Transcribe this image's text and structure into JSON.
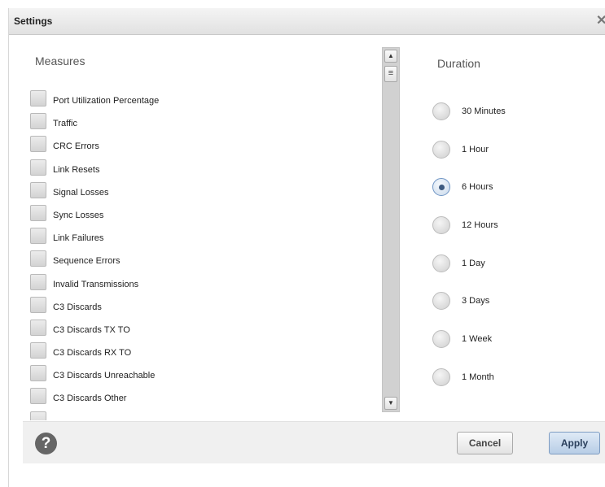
{
  "dialog": {
    "title": "Settings",
    "close_glyph": "✕"
  },
  "measures": {
    "heading": "Measures",
    "items": [
      {
        "label": "Port Utilization Percentage",
        "checked": false
      },
      {
        "label": "Traffic",
        "checked": false
      },
      {
        "label": "CRC Errors",
        "checked": false
      },
      {
        "label": "Link Resets",
        "checked": false
      },
      {
        "label": "Signal Losses",
        "checked": false
      },
      {
        "label": "Sync Losses",
        "checked": false
      },
      {
        "label": "Link Failures",
        "checked": false
      },
      {
        "label": "Sequence Errors",
        "checked": false
      },
      {
        "label": "Invalid Transmissions",
        "checked": false
      },
      {
        "label": "C3 Discards",
        "checked": false
      },
      {
        "label": "C3 Discards TX TO",
        "checked": false
      },
      {
        "label": "C3 Discards RX TO",
        "checked": false
      },
      {
        "label": "C3 Discards Unreachable",
        "checked": false
      },
      {
        "label": "C3 Discards Other",
        "checked": false
      },
      {
        "label": "",
        "checked": false
      }
    ]
  },
  "scrollbar": {
    "up_glyph": "▲",
    "down_glyph": "▼",
    "grip_glyph": "≡"
  },
  "duration": {
    "heading": "Duration",
    "options": [
      {
        "label": "30 Minutes",
        "selected": false
      },
      {
        "label": "1 Hour",
        "selected": false
      },
      {
        "label": "6 Hours",
        "selected": true
      },
      {
        "label": "12 Hours",
        "selected": false
      },
      {
        "label": "1 Day",
        "selected": false
      },
      {
        "label": "3 Days",
        "selected": false
      },
      {
        "label": "1 Week",
        "selected": false
      },
      {
        "label": "1 Month",
        "selected": false
      }
    ]
  },
  "footer": {
    "help_glyph": "?",
    "cancel_label": "Cancel",
    "apply_label": "Apply"
  },
  "colors": {
    "selected_radio_dot": "#3d5a80",
    "apply_button": "#b7cde6"
  }
}
